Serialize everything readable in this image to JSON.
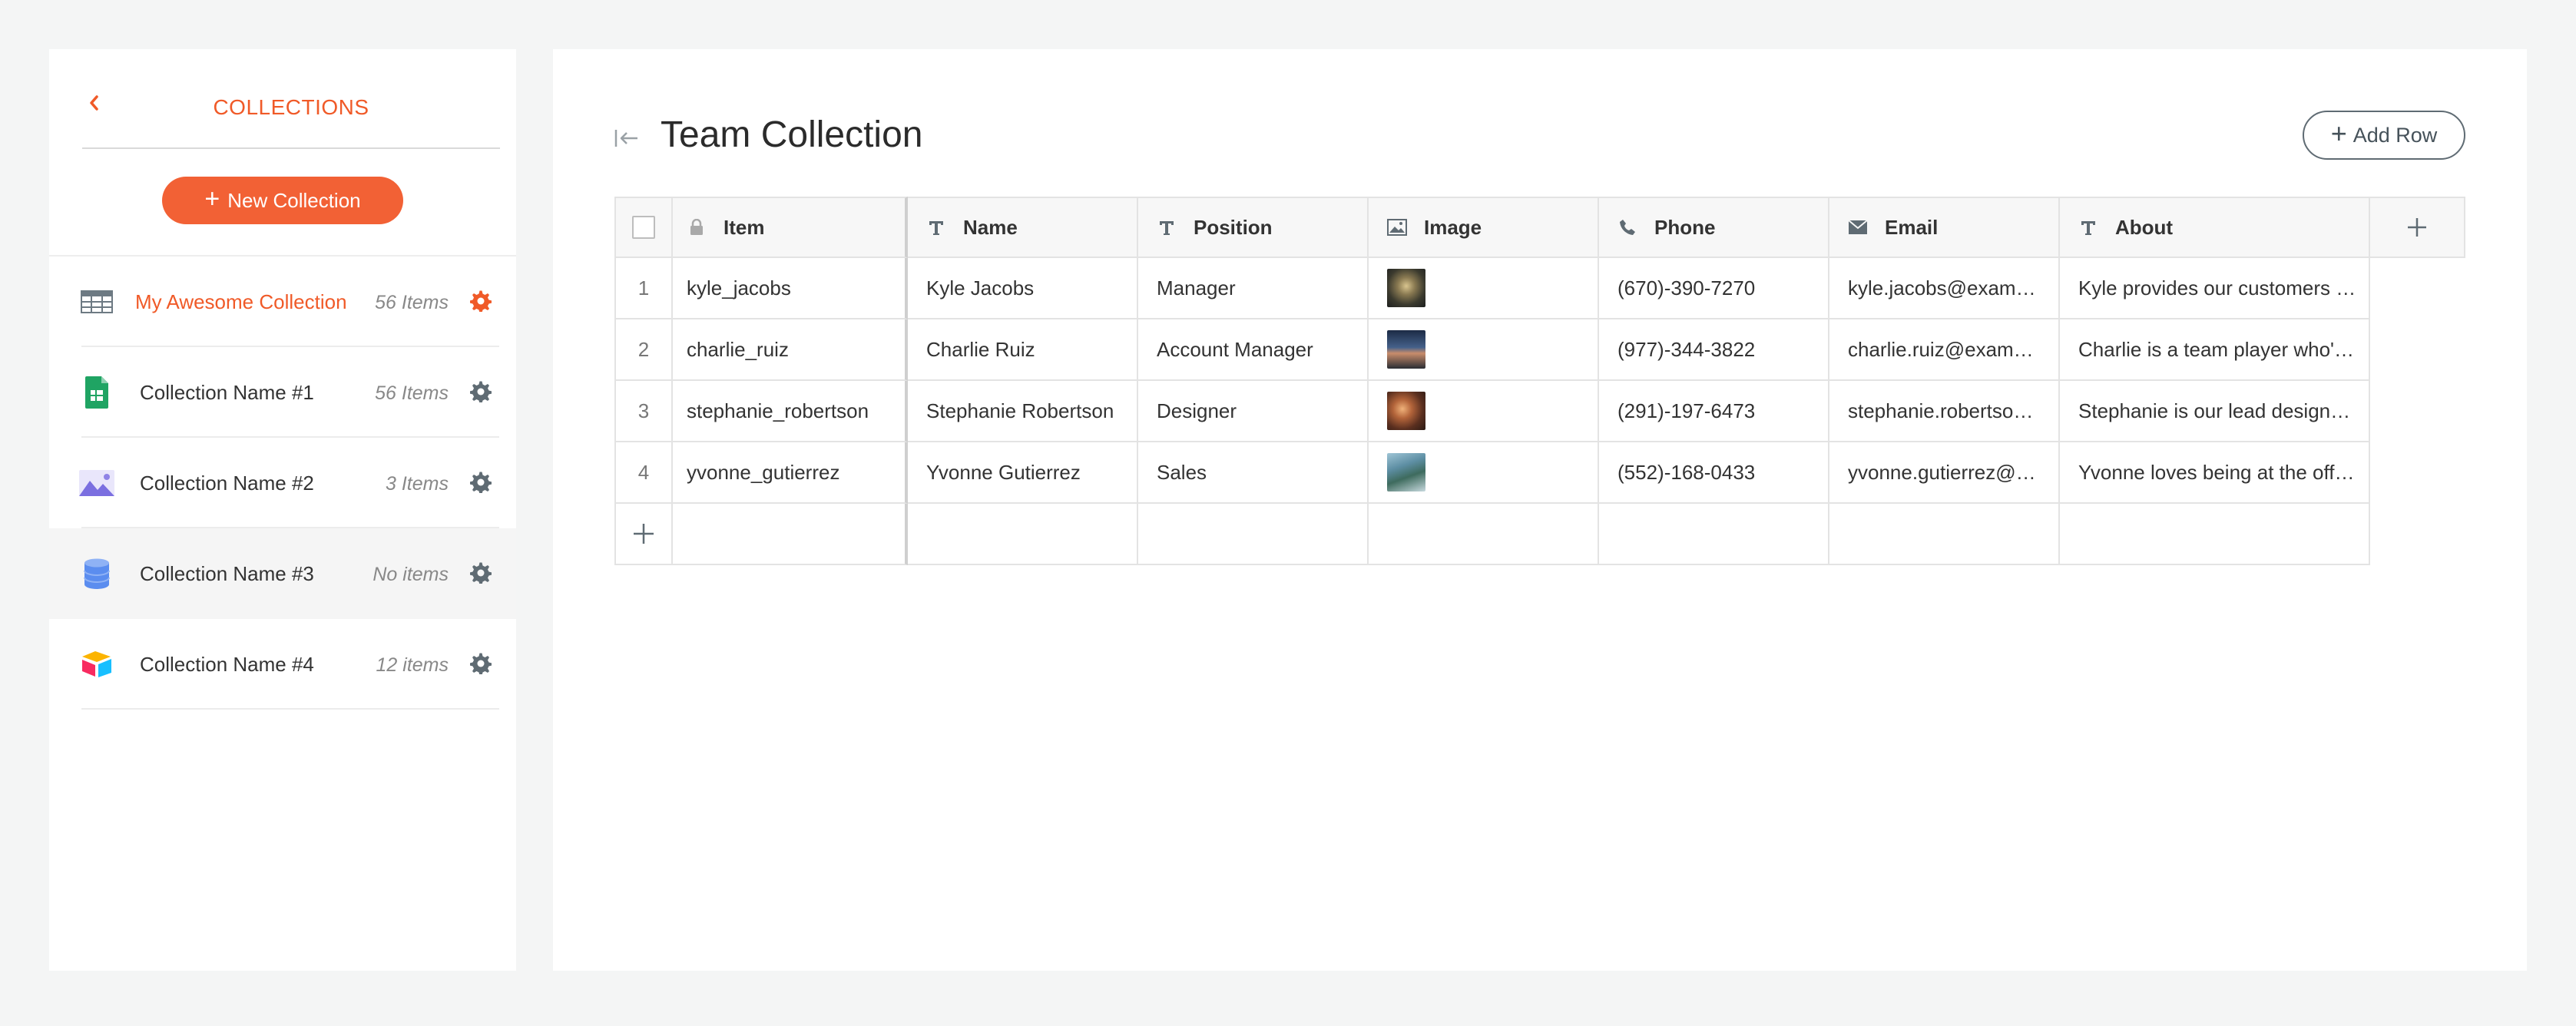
{
  "sidebar": {
    "title": "COLLECTIONS",
    "new_collection_label": "New Collection",
    "items": [
      {
        "name": "My Awesome Collection",
        "count": "56 Items",
        "icon": "table-icon",
        "active": true
      },
      {
        "name": "Collection Name #1",
        "count": "56 Items",
        "icon": "google-sheets-icon",
        "active": false
      },
      {
        "name": "Collection Name #2",
        "count": "3 Items",
        "icon": "image-icon",
        "active": false
      },
      {
        "name": "Collection Name #3",
        "count": "No items",
        "icon": "database-icon",
        "active": false
      },
      {
        "name": "Collection Name #4",
        "count": "12 items",
        "icon": "airtable-icon",
        "active": false
      }
    ]
  },
  "main": {
    "title": "Team Collection",
    "add_row_label": "Add Row",
    "columns": [
      {
        "label": "Item",
        "icon": "lock-icon"
      },
      {
        "label": "Name",
        "icon": "text-type-icon"
      },
      {
        "label": "Position",
        "icon": "text-type-icon"
      },
      {
        "label": "Image",
        "icon": "image-type-icon"
      },
      {
        "label": "Phone",
        "icon": "phone-icon"
      },
      {
        "label": "Email",
        "icon": "email-icon"
      },
      {
        "label": "About",
        "icon": "text-type-icon"
      }
    ],
    "rows": [
      {
        "num": "1",
        "item": "kyle_jacobs",
        "name": "Kyle Jacobs",
        "position": "Manager",
        "phone": "(670)-390-7270",
        "email": "kyle.jacobs@exam…",
        "about": "Kyle provides our customers …"
      },
      {
        "num": "2",
        "item": "charlie_ruiz",
        "name": "Charlie Ruiz",
        "position": "Account Manager",
        "phone": "(977)-344-3822",
        "email": "charlie.ruiz@exam…",
        "about": "Charlie is a team player who'…"
      },
      {
        "num": "3",
        "item": "stephanie_robertson",
        "name": "Stephanie Robertson",
        "position": "Designer",
        "phone": "(291)-197-6473",
        "email": "stephanie.robertso…",
        "about": "Stephanie is our lead design…"
      },
      {
        "num": "4",
        "item": "yvonne_gutierrez",
        "name": "Yvonne Gutierrez",
        "position": "Sales",
        "phone": "(552)-168-0433",
        "email": "yvonne.gutierrez@…",
        "about": "Yvonne loves being at the off…"
      }
    ]
  },
  "colors": {
    "accent": "#f26135",
    "accent_text": "#f05a28",
    "icon_gray": "#5f6b73"
  }
}
